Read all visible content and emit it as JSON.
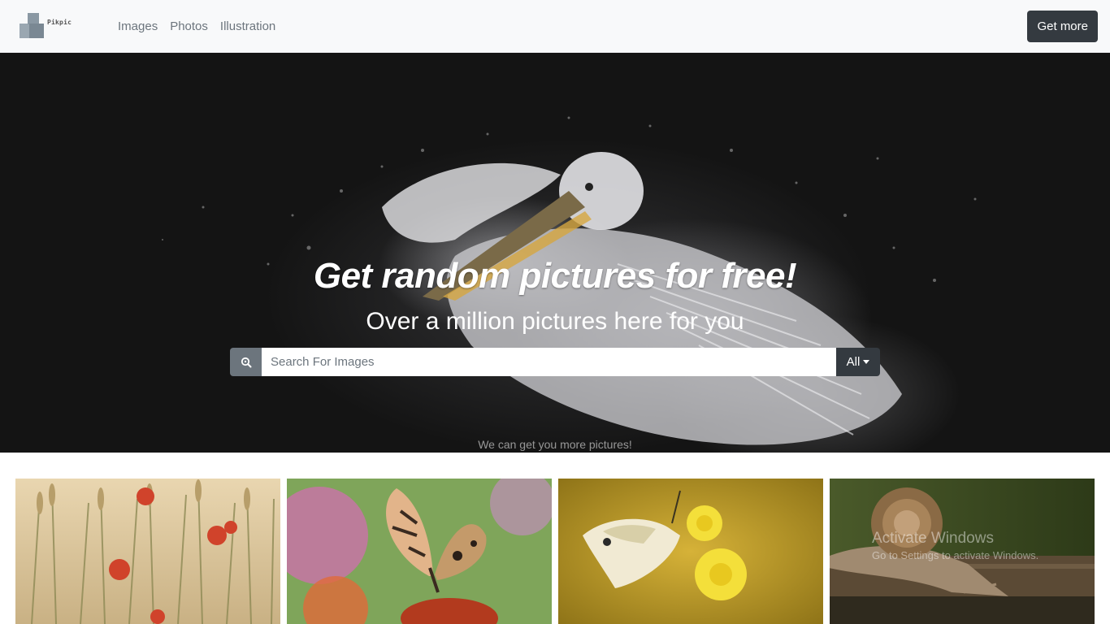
{
  "brand": {
    "name": "Pikpic"
  },
  "nav": {
    "links": [
      "Images",
      "Photos",
      "Illustration"
    ],
    "cta_label": "Get more"
  },
  "hero": {
    "title": "Get random pictures for free!",
    "subtitle": "Over a million pictures here for you",
    "search": {
      "placeholder": "Search For Images",
      "value": "",
      "category_selected": "All"
    },
    "note": "We can get you more pictures!"
  },
  "gallery": {
    "items": [
      {
        "subject": "poppies-and-wheat"
      },
      {
        "subject": "butterfly-on-coneflower"
      },
      {
        "subject": "white-butterfly-on-yellow-flower"
      },
      {
        "subject": "snail-on-wood"
      }
    ]
  },
  "os_watermark": {
    "line1": "Activate Windows",
    "line2": "Go to Settings to activate Windows."
  },
  "colors": {
    "navbar_bg": "#f8f9fa",
    "dark_button": "#343a40",
    "search_icon_bg": "#6c757d",
    "nav_link": "#6c757d"
  }
}
